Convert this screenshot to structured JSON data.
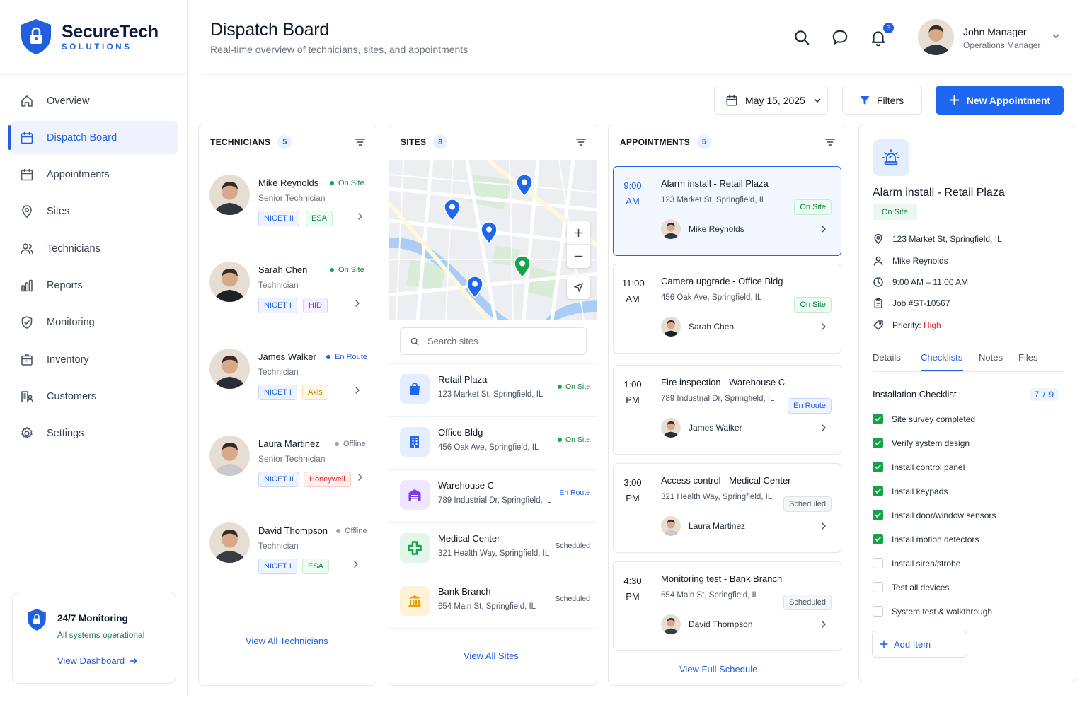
{
  "brand": {
    "name": "SecureTech",
    "sub": "SOLUTIONS"
  },
  "nav": [
    {
      "label": "Overview",
      "icon": "home-icon"
    },
    {
      "label": "Dispatch Board",
      "icon": "calendar-icon",
      "active": true
    },
    {
      "label": "Appointments",
      "icon": "calendar-icon"
    },
    {
      "label": "Sites",
      "icon": "map-pin-icon"
    },
    {
      "label": "Technicians",
      "icon": "users-icon"
    },
    {
      "label": "Reports",
      "icon": "bar-chart-icon"
    },
    {
      "label": "Monitoring",
      "icon": "shield-check-icon"
    },
    {
      "label": "Inventory",
      "icon": "box-icon"
    },
    {
      "label": "Customers",
      "icon": "customers-icon"
    },
    {
      "label": "Settings",
      "icon": "gear-icon"
    }
  ],
  "monitoring": {
    "title": "24/7 Monitoring",
    "status": "All systems operational",
    "link": "View Dashboard"
  },
  "header": {
    "title": "Dispatch Board",
    "subtitle": "Real-time overview of technicians, sites, and appointments",
    "notifications": "3",
    "user_name": "John Manager",
    "user_role": "Operations Manager"
  },
  "toolbar": {
    "date": "May 15, 2025",
    "filters": "Filters",
    "new_appointment": "New Appointment"
  },
  "technicians": {
    "title": "TECHNICIANS",
    "count": "5",
    "footer": "View All Technicians",
    "items": [
      {
        "name": "Mike Reynolds",
        "role": "Senior Technician",
        "status": "On Site",
        "tags": [
          "NICET II",
          "ESA"
        ]
      },
      {
        "name": "Sarah Chen",
        "role": "Technician",
        "status": "On Site",
        "tags": [
          "NICET I",
          "HID"
        ]
      },
      {
        "name": "James Walker",
        "role": "Technician",
        "status": "En Route",
        "tags": [
          "NICET I",
          "Axis"
        ]
      },
      {
        "name": "Laura Martinez",
        "role": "Senior Technician",
        "status": "Offline",
        "tags": [
          "NICET II",
          "Honeywell"
        ]
      },
      {
        "name": "David Thompson",
        "role": "Technician",
        "status": "Offline",
        "tags": [
          "NICET I",
          "ESA"
        ]
      }
    ]
  },
  "sites": {
    "title": "SITES",
    "count": "8",
    "search_placeholder": "Search sites",
    "footer": "View All Sites",
    "items": [
      {
        "name": "Retail Plaza",
        "address": "123 Market St, Springfield, IL",
        "status": "On Site",
        "icon": "shopping-bag-icon"
      },
      {
        "name": "Office Bldg",
        "address": "456 Oak Ave, Springfield, IL",
        "status": "On Site",
        "icon": "building-icon"
      },
      {
        "name": "Warehouse C",
        "address": "789 Industrial Dr, Springfield, IL",
        "status": "En Route",
        "icon": "warehouse-icon"
      },
      {
        "name": "Medical Center",
        "address": "321 Health Way, Springfield, IL",
        "status": "Scheduled",
        "icon": "medical-cross-icon"
      },
      {
        "name": "Bank Branch",
        "address": "654 Main St, Springfield, IL",
        "status": "Scheduled",
        "icon": "bank-icon"
      }
    ]
  },
  "appointments": {
    "title": "APPOINTMENTS",
    "count": "5",
    "footer": "View Full Schedule",
    "items": [
      {
        "time": "9:00",
        "period": "AM",
        "title": "Alarm install - Retail Plaza",
        "address": "123 Market St, Springfield, IL",
        "status": "On Site",
        "tech": "Mike Reynolds"
      },
      {
        "time": "11:00",
        "period": "AM",
        "title": "Camera upgrade - Office Bldg",
        "address": "456 Oak Ave, Springfield, IL",
        "status": "On Site",
        "tech": "Sarah Chen"
      },
      {
        "time": "1:00",
        "period": "PM",
        "title": "Fire inspection - Warehouse C",
        "address": "789 Industrial Dr, Springfield, IL",
        "status": "En Route",
        "tech": "James Walker"
      },
      {
        "time": "3:00",
        "period": "PM",
        "title": "Access control - Medical Center",
        "address": "321 Health Way, Springfield, IL",
        "status": "Scheduled",
        "tech": "Laura Martinez"
      },
      {
        "time": "4:30",
        "period": "PM",
        "title": "Monitoring test - Bank Branch",
        "address": "654 Main St, Springfield, IL",
        "status": "Scheduled",
        "tech": "David Thompson"
      }
    ]
  },
  "detail": {
    "title": "Alarm install - Retail Plaza",
    "status": "On Site",
    "address": "123 Market St, Springfield, IL",
    "technician": "Mike Reynolds",
    "time": "9:00 AM – 11:00 AM",
    "job": "Job #ST-10567",
    "priority_label": "Priority:",
    "priority": "High",
    "tabs": [
      "Details",
      "Checklists",
      "Notes",
      "Files"
    ],
    "checklist_title": "Installation Checklist",
    "checklist_count": "7 / 9",
    "checklist": [
      {
        "label": "Site survey completed",
        "done": true
      },
      {
        "label": "Verify system design",
        "done": true
      },
      {
        "label": "Install control panel",
        "done": true
      },
      {
        "label": "Install keypads",
        "done": true
      },
      {
        "label": "Install door/window sensors",
        "done": true
      },
      {
        "label": "Install motion detectors",
        "done": true
      },
      {
        "label": "Install siren/strobe",
        "done": false
      },
      {
        "label": "Test all devices",
        "done": false
      },
      {
        "label": "System test & walkthrough",
        "done": false
      }
    ],
    "add_item": "Add Item"
  },
  "colors": {
    "accent": "#1f66f0",
    "on_site": "#16a34a",
    "en_route": "#1f5fe0",
    "offline": "#9ca3af",
    "priority_high": "#dc2626"
  }
}
